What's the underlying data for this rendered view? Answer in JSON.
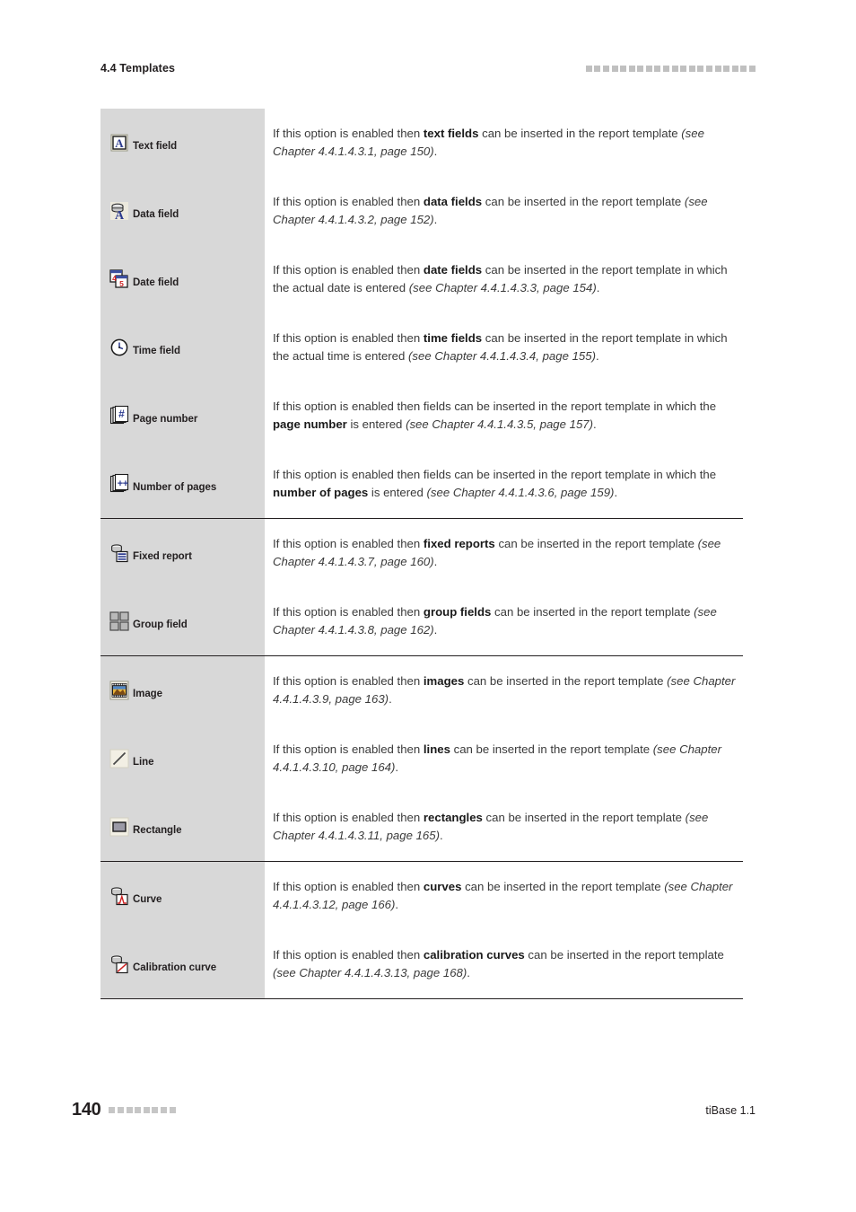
{
  "header": {
    "section_title": "4.4 Templates",
    "marker_squares": 20
  },
  "footer": {
    "page_number": "140",
    "marker_squares": 8,
    "product": "tiBase 1.1"
  },
  "table": {
    "groups": [
      {
        "rows": [
          {
            "icon": "text-field-icon",
            "label": "Text field",
            "desc_parts": [
              {
                "t": "If this option is enabled then ",
                "s": "n"
              },
              {
                "t": "text fields",
                "s": "b"
              },
              {
                "t": " can be inserted in the report template ",
                "s": "n"
              },
              {
                "t": "(see Chapter 4.4.1.4.3.1, page 150)",
                "s": "i"
              },
              {
                "t": ".",
                "s": "n"
              }
            ]
          },
          {
            "icon": "data-field-icon",
            "label": "Data field",
            "desc_parts": [
              {
                "t": "If this option is enabled then ",
                "s": "n"
              },
              {
                "t": "data fields",
                "s": "b"
              },
              {
                "t": " can be inserted in the report template ",
                "s": "n"
              },
              {
                "t": "(see Chapter 4.4.1.4.3.2, page 152)",
                "s": "i"
              },
              {
                "t": ".",
                "s": "n"
              }
            ]
          },
          {
            "icon": "date-field-icon",
            "label": "Date field",
            "desc_parts": [
              {
                "t": "If this option is enabled then ",
                "s": "n"
              },
              {
                "t": "date fields",
                "s": "b"
              },
              {
                "t": " can be inserted in the report template in which the actual date is entered ",
                "s": "n"
              },
              {
                "t": "(see Chapter 4.4.1.4.3.3, page 154)",
                "s": "i"
              },
              {
                "t": ".",
                "s": "n"
              }
            ]
          },
          {
            "icon": "time-field-icon",
            "label": "Time field",
            "desc_parts": [
              {
                "t": "If this option is enabled then ",
                "s": "n"
              },
              {
                "t": "time fields",
                "s": "b"
              },
              {
                "t": " can be inserted in the report template in which the actual time is entered ",
                "s": "n"
              },
              {
                "t": "(see Chapter 4.4.1.4.3.4, page 155)",
                "s": "i"
              },
              {
                "t": ".",
                "s": "n"
              }
            ]
          },
          {
            "icon": "page-number-icon",
            "label": "Page number",
            "desc_parts": [
              {
                "t": "If this option is enabled then fields can be inserted in the report template in which the ",
                "s": "n"
              },
              {
                "t": "page number",
                "s": "b"
              },
              {
                "t": " is entered ",
                "s": "n"
              },
              {
                "t": "(see Chapter 4.4.1.4.3.5, page 157)",
                "s": "i"
              },
              {
                "t": ".",
                "s": "n"
              }
            ]
          },
          {
            "icon": "number-of-pages-icon",
            "label": "Number of pages",
            "desc_parts": [
              {
                "t": "If this option is enabled then fields can be inserted in the report template in which the ",
                "s": "n"
              },
              {
                "t": "number of pages",
                "s": "b"
              },
              {
                "t": " is entered ",
                "s": "n"
              },
              {
                "t": "(see Chapter 4.4.1.4.3.6, page 159)",
                "s": "i"
              },
              {
                "t": ".",
                "s": "n"
              }
            ]
          }
        ]
      },
      {
        "rows": [
          {
            "icon": "fixed-report-icon",
            "label": "Fixed report",
            "desc_parts": [
              {
                "t": "If this option is enabled then ",
                "s": "n"
              },
              {
                "t": "fixed reports",
                "s": "b"
              },
              {
                "t": " can be inserted in the report tem­plate ",
                "s": "n"
              },
              {
                "t": "(see Chapter 4.4.1.4.3.7, page 160)",
                "s": "i"
              },
              {
                "t": ".",
                "s": "n"
              }
            ]
          },
          {
            "icon": "group-field-icon",
            "label": "Group field",
            "desc_parts": [
              {
                "t": "If this option is enabled then ",
                "s": "n"
              },
              {
                "t": "group fields",
                "s": "b"
              },
              {
                "t": " can be inserted in the report tem­plate ",
                "s": "n"
              },
              {
                "t": "(see Chapter 4.4.1.4.3.8, page 162)",
                "s": "i"
              },
              {
                "t": ".",
                "s": "n"
              }
            ]
          }
        ]
      },
      {
        "rows": [
          {
            "icon": "image-icon",
            "label": "Image",
            "desc_parts": [
              {
                "t": "If this option is enabled then ",
                "s": "n"
              },
              {
                "t": "images",
                "s": "b"
              },
              {
                "t": " can be inserted in the report template ",
                "s": "n"
              },
              {
                "t": "(see Chapter 4.4.1.4.3.9, page 163)",
                "s": "i"
              },
              {
                "t": ".",
                "s": "n"
              }
            ]
          },
          {
            "icon": "line-icon",
            "label": "Line",
            "desc_parts": [
              {
                "t": "If this option is enabled then ",
                "s": "n"
              },
              {
                "t": "lines",
                "s": "b"
              },
              {
                "t": " can be inserted in the report template ",
                "s": "n"
              },
              {
                "t": "(see Chapter 4.4.1.4.3.10, page 164)",
                "s": "i"
              },
              {
                "t": ".",
                "s": "n"
              }
            ]
          },
          {
            "icon": "rectangle-icon",
            "label": "Rectangle",
            "desc_parts": [
              {
                "t": "If this option is enabled then ",
                "s": "n"
              },
              {
                "t": "rectangles",
                "s": "b"
              },
              {
                "t": " can be inserted in the report template ",
                "s": "n"
              },
              {
                "t": "(see Chapter 4.4.1.4.3.11, page 165)",
                "s": "i"
              },
              {
                "t": ".",
                "s": "n"
              }
            ]
          }
        ]
      },
      {
        "rows": [
          {
            "icon": "curve-icon",
            "label": "Curve",
            "desc_parts": [
              {
                "t": "If this option is enabled then ",
                "s": "n"
              },
              {
                "t": "curves",
                "s": "b"
              },
              {
                "t": " can be inserted in the report template ",
                "s": "n"
              },
              {
                "t": "(see Chapter 4.4.1.4.3.12, page 166)",
                "s": "i"
              },
              {
                "t": ".",
                "s": "n"
              }
            ]
          },
          {
            "icon": "calibration-curve-icon",
            "label": "Calibration curve",
            "desc_parts": [
              {
                "t": "If this option is enabled then ",
                "s": "n"
              },
              {
                "t": "calibration curves",
                "s": "b"
              },
              {
                "t": " can be inserted in the report template ",
                "s": "n"
              },
              {
                "t": "(see Chapter 4.4.1.4.3.13, page 168)",
                "s": "i"
              },
              {
                "t": ".",
                "s": "n"
              }
            ]
          }
        ]
      }
    ]
  },
  "colors": {
    "icon_column_bg": "#d8d8d8",
    "rule": "#231f20",
    "marker": "#c6c6c6",
    "icon_blue": "#2c3b8f",
    "icon_red": "#cc2222"
  }
}
